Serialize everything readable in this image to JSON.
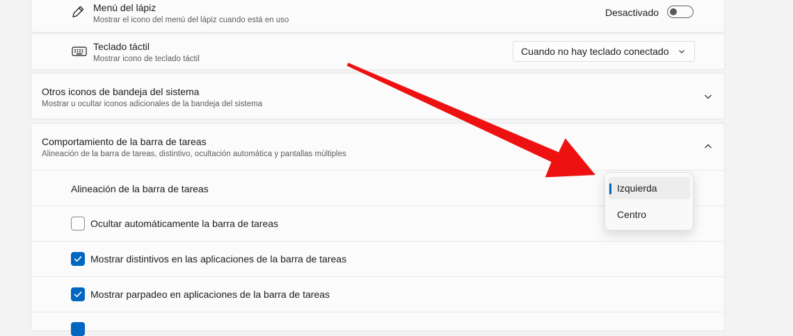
{
  "pen_menu": {
    "title": "Menú del lápiz",
    "description": "Mostrar el icono del menú del lápiz cuando está en uso",
    "toggle_label": "Desactivado",
    "toggle_on": false,
    "icon": "pen-icon"
  },
  "touch_keyboard": {
    "title": "Teclado táctil",
    "description": "Mostrar icono de teclado táctil",
    "dropdown_value": "Cuando no hay teclado conectado",
    "icon": "keyboard-icon"
  },
  "other_tray_icons": {
    "title": "Otros iconos de bandeja del sistema",
    "description": "Mostrar u ocultar iconos adicionales de la bandeja del sistema",
    "expanded": false
  },
  "taskbar_behaviors": {
    "title": "Comportamiento de la barra de tareas",
    "description": "Alineación de la barra de tareas, distintivo, ocultación automática y pantallas múltiples",
    "expanded": true,
    "alignment_label": "Alineación de la barra de tareas",
    "alignment_options": [
      "Izquierda",
      "Centro"
    ],
    "alignment_selected": "Izquierda",
    "options": [
      {
        "label": "Ocultar automáticamente la barra de tareas",
        "checked": false
      },
      {
        "label": "Mostrar distintivos en las aplicaciones de la barra de tareas",
        "checked": true
      },
      {
        "label": "Mostrar parpadeo en aplicaciones de la barra de tareas",
        "checked": true
      }
    ]
  },
  "colors": {
    "accent": "#0067c0",
    "annotation_arrow": "#ee1111",
    "background": "#f3f3f3",
    "card": "#fbfbfb"
  }
}
